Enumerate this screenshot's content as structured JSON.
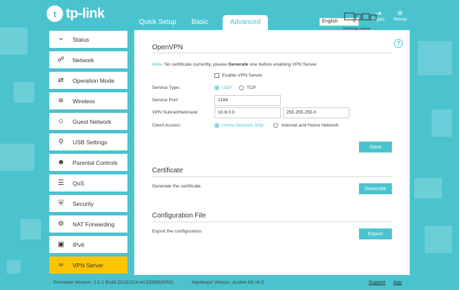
{
  "brand": {
    "name": "tp-link",
    "accent": "#4bc3cf",
    "active_nav": "#ffc400"
  },
  "header": {
    "tabs": [
      {
        "label": "Quick Setup"
      },
      {
        "label": "Basic"
      },
      {
        "label": "Advanced",
        "active": true
      }
    ],
    "language": "English",
    "logout_label": "Logout",
    "reboot_label": "Reboot",
    "overlay_text": "technology.compl.pl"
  },
  "sidebar": {
    "items": [
      {
        "label": "Status",
        "icon": "status-icon"
      },
      {
        "label": "Network",
        "icon": "network-icon"
      },
      {
        "label": "Operation Mode",
        "icon": "operation-mode-icon"
      },
      {
        "label": "Wireless",
        "icon": "wireless-icon"
      },
      {
        "label": "Guest Network",
        "icon": "guest-network-icon"
      },
      {
        "label": "USB Settings",
        "icon": "usb-icon"
      },
      {
        "label": "Parental Controls",
        "icon": "parental-controls-icon"
      },
      {
        "label": "QoS",
        "icon": "qos-icon"
      },
      {
        "label": "Security",
        "icon": "shield-icon"
      },
      {
        "label": "NAT Forwarding",
        "icon": "nat-forwarding-icon"
      },
      {
        "label": "IPv6",
        "icon": "ipv6-icon"
      },
      {
        "label": "VPN Server",
        "icon": "vpn-icon",
        "active": true
      }
    ]
  },
  "openvpn": {
    "title": "OpenVPN",
    "note_label": "Note:",
    "note_before": "No certificate currently, please",
    "note_bold": "Generate",
    "note_after": "one before enabling VPN Server.",
    "enable_label": "Enable VPN Server",
    "service_type_label": "Service Type:",
    "service_type_options": [
      "UDP",
      "TCP"
    ],
    "service_type_selected": "UDP",
    "service_port_label": "Service Port:",
    "service_port_value": "1194",
    "subnet_label": "VPN Subnet/Netmask:",
    "subnet_value": "10.8.0.0",
    "netmask_value": "255.255.255.0",
    "client_access_label": "Client Access:",
    "client_access_options": [
      "Home Network Only",
      "Internet and Home Network"
    ],
    "client_access_selected": "Home Network Only",
    "save_label": "Save"
  },
  "certificate": {
    "title": "Certificate",
    "description": "Generate the certificate.",
    "button_label": "Generate"
  },
  "config_file": {
    "title": "Configuration File",
    "description": "Export the configuration.",
    "button_label": "Export"
  },
  "footer": {
    "firmware": "Firmware Version: 1.0.1 Build 20181114 rel.62999(4555)",
    "hardware": "Hardware Version: Archer A9 v6.0",
    "support_label": "Support",
    "app_label": "App"
  }
}
